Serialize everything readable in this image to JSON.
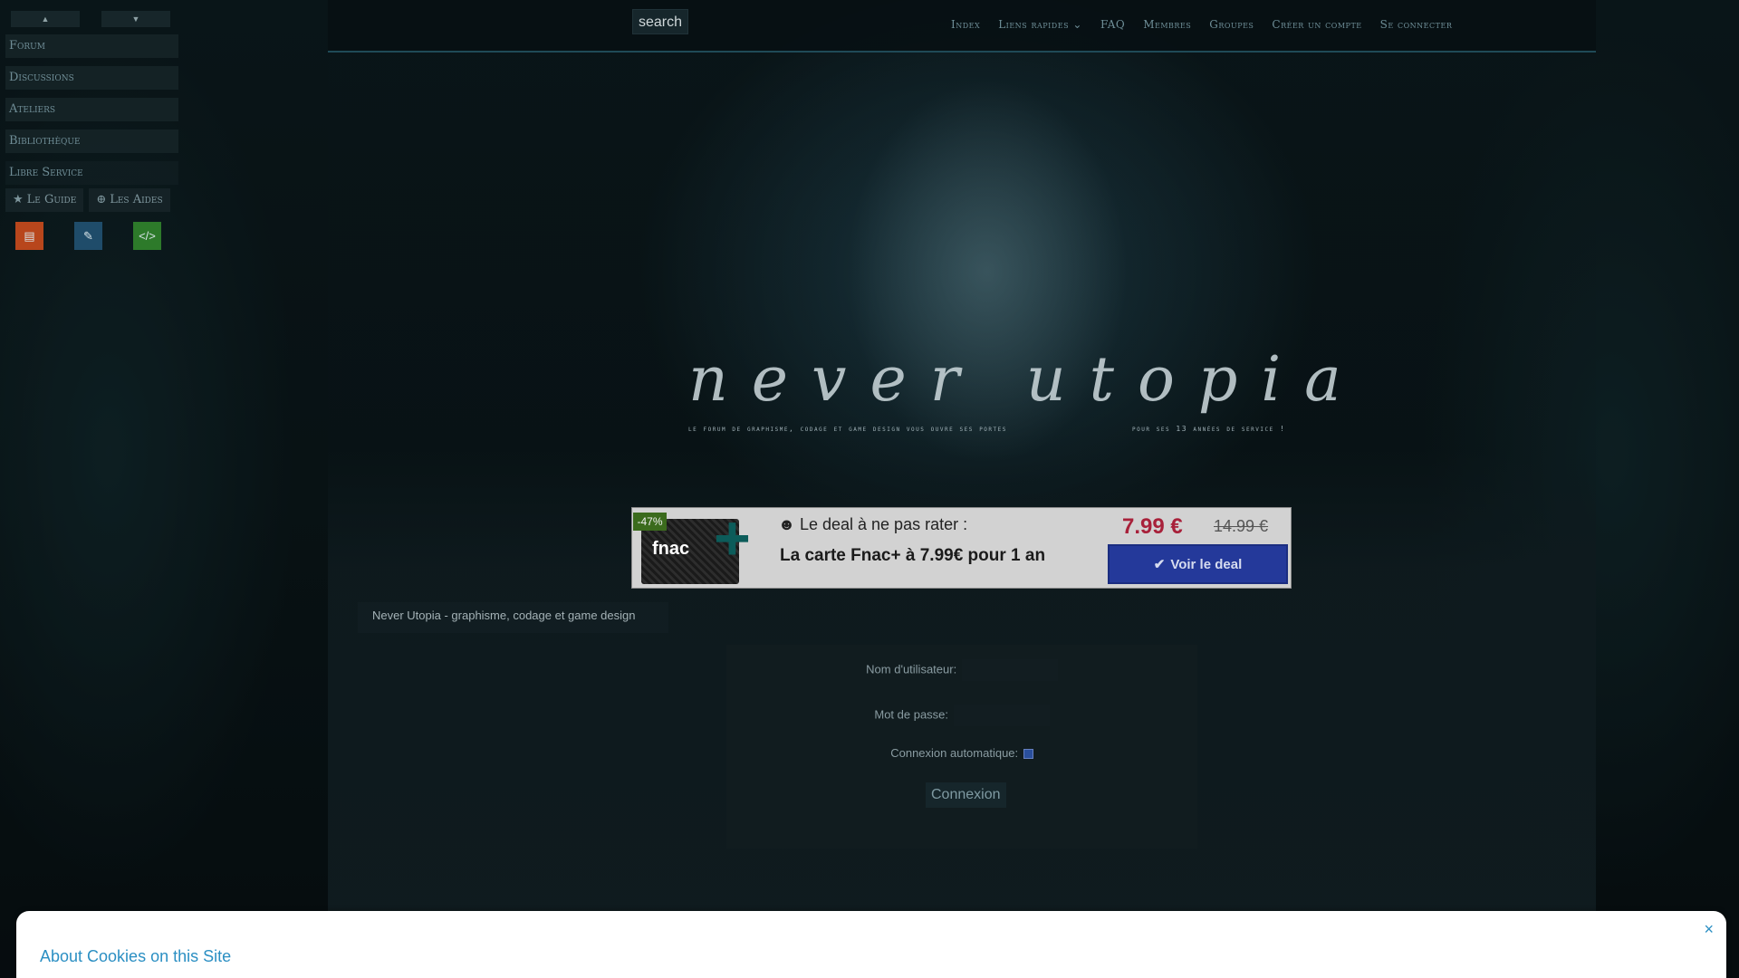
{
  "topbar": {
    "search_label": "search",
    "nav": [
      "Index",
      "Liens rapides",
      "FAQ",
      "Membres",
      "Groupes",
      "Créer un compte",
      "Se connecter"
    ]
  },
  "sidebar": {
    "items": [
      "Forum",
      "Discussions",
      "Ateliers",
      "Bibliothèque",
      "Libre Service"
    ],
    "guide_label": "Le Guide",
    "aides_label": "Les Aides",
    "icons": [
      {
        "name": "book-icon",
        "color": "#b8461c"
      },
      {
        "name": "brush-icon",
        "color": "#1f4c6a"
      },
      {
        "name": "code-icon",
        "color": "#2d7a2a"
      }
    ]
  },
  "banner": {
    "logo_text": "never utopia",
    "tagline_left": "Le forum de graphisme, codage et game design vous ouvre ses portes",
    "tagline_right": "pour ses 13 années de service !"
  },
  "deal": {
    "badge": "-47%",
    "brand": "fnac",
    "title": "Le deal à ne pas rater :",
    "subtitle": "La carte Fnac+ à 7.99€ pour 1 an",
    "price": "7.99 €",
    "old_price": "14.99 €",
    "button_label": "Voir le deal",
    "colors": {
      "price": "#a8213a",
      "button": "#24399a"
    }
  },
  "breadcrumb": "Never Utopia - graphisme, codage et game design",
  "login": {
    "username_label": "Nom d'utilisateur:",
    "password_label": "Mot de passe:",
    "auto_label": "Connexion automatique:",
    "auto_checked": true,
    "submit_label": "Connexion"
  },
  "cookie": {
    "title": "About Cookies on this Site",
    "close": "×"
  }
}
